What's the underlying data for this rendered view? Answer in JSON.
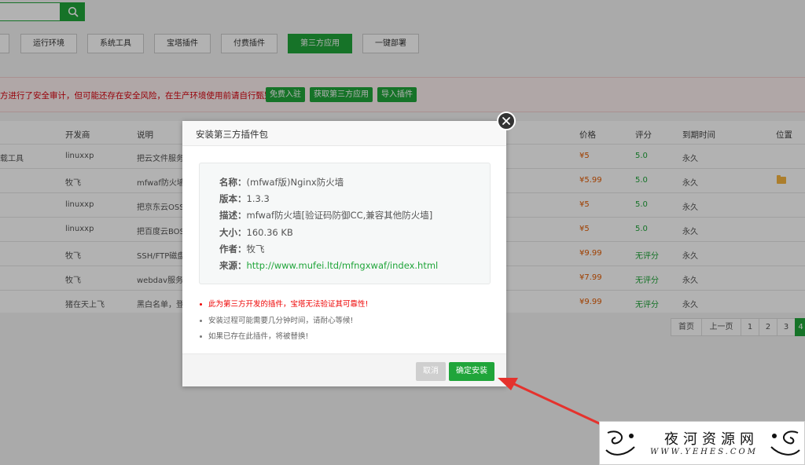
{
  "search": {
    "placeholder": ""
  },
  "tabs": [
    {
      "label": "运行环境"
    },
    {
      "label": "系统工具"
    },
    {
      "label": "宝塔插件"
    },
    {
      "label": "付费插件"
    },
    {
      "label": "第三方应用",
      "active": true
    },
    {
      "label": "一键部署"
    }
  ],
  "warning": {
    "text": "方进行了安全审计，但可能还存在安全风险，在生产环境使用前请自行甄别",
    "buttons": [
      "免费入驻",
      "获取第三方应用",
      "导入插件"
    ]
  },
  "table": {
    "headers": [
      "开发商",
      "说明",
      "价格",
      "评分",
      "到期时间",
      "位置"
    ],
    "rows": [
      {
        "name": "载工具",
        "developer": "linuxxp",
        "desc": "把云文件服务",
        "price": "¥5",
        "score": "5.0",
        "expire": "永久",
        "folder": false
      },
      {
        "name": "",
        "developer": "牧飞",
        "desc": "mfwaf防火墙",
        "price": "¥5.99",
        "score": "5.0",
        "expire": "永久",
        "folder": true
      },
      {
        "name": "",
        "developer": "linuxxp",
        "desc": "把京东云OSS",
        "price": "¥5",
        "score": "5.0",
        "expire": "永久",
        "folder": false
      },
      {
        "name": "",
        "developer": "linuxxp",
        "desc": "把百度云BOS",
        "price": "¥5",
        "score": "5.0",
        "expire": "永久",
        "folder": false
      },
      {
        "name": "",
        "developer": "牧飞",
        "desc": "SSH/FTP磁盘",
        "price": "¥9.99",
        "score": "无评分",
        "expire": "永久",
        "folder": false
      },
      {
        "name": "",
        "developer": "牧飞",
        "desc": "webdav服务",
        "price": "¥7.99",
        "score": "无评分",
        "expire": "永久",
        "folder": false
      },
      {
        "name": "",
        "developer": "猪在天上飞",
        "desc": "黑白名单，登",
        "price": "¥9.99",
        "score": "无评分",
        "expire": "永久",
        "folder": false
      }
    ]
  },
  "pagination": {
    "first": "首页",
    "prev": "上一页",
    "pages": [
      "1",
      "2",
      "3",
      "4"
    ],
    "current": "4"
  },
  "modal": {
    "title": "安装第三方插件包",
    "info": {
      "name_label": "名称：",
      "name": "(mfwaf版)Nginx防火墙",
      "version_label": "版本：",
      "version": "1.3.3",
      "desc_label": "描述：",
      "desc": "mfwaf防火墙[验证码防御CC,兼容其他防火墙]",
      "size_label": "大小：",
      "size": "160.36 KB",
      "author_label": "作者：",
      "author": "牧飞",
      "source_label": "来源：",
      "source": "http://www.mufei.ltd/mfngxwaf/index.html"
    },
    "tips": [
      "此为第三方开发的插件，宝塔无法验证其可靠性!",
      "安装过程可能需要几分钟时间，请耐心等候!",
      "如果已存在此插件，将被替换!"
    ],
    "cancel_label": "取消",
    "confirm_label": "确定安装"
  },
  "watermark": {
    "title": "夜河资源网",
    "url": "WWW.YEHES.COM"
  },
  "colors": {
    "accent": "#20a53a",
    "warning": "#d8000c",
    "price": "#e45b00",
    "arrow": "#e5322d"
  }
}
